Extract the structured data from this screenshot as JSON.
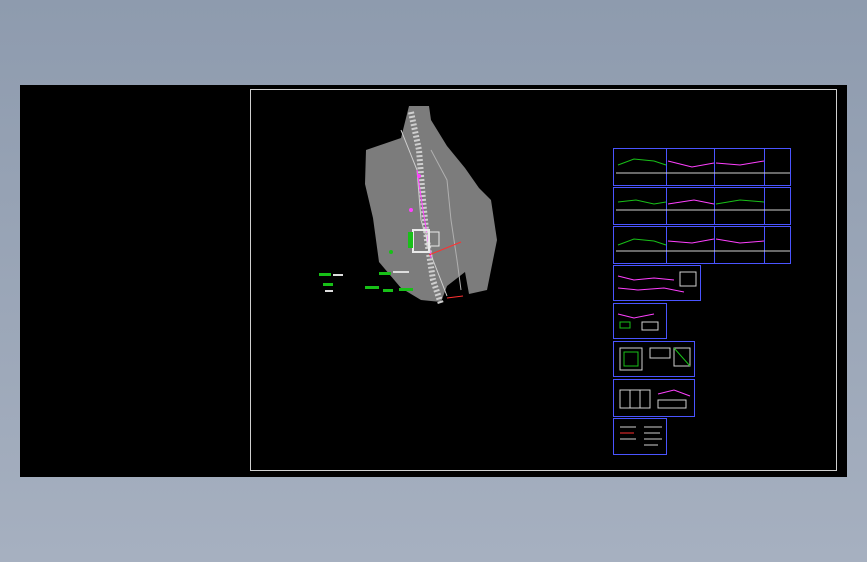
{
  "viewer": {
    "background_color": "#000000",
    "frame_color": "#4a54ff",
    "border_color": "#cfcfcf"
  },
  "drawing": {
    "sheets": [
      {
        "name": "profile-sheet-1"
      },
      {
        "name": "profile-sheet-2"
      },
      {
        "name": "profile-sheet-3"
      },
      {
        "name": "section-sheet"
      },
      {
        "name": "detail-sheet-1"
      },
      {
        "name": "structure-sheet-1"
      },
      {
        "name": "structure-sheet-2"
      },
      {
        "name": "notes-sheet"
      }
    ]
  }
}
